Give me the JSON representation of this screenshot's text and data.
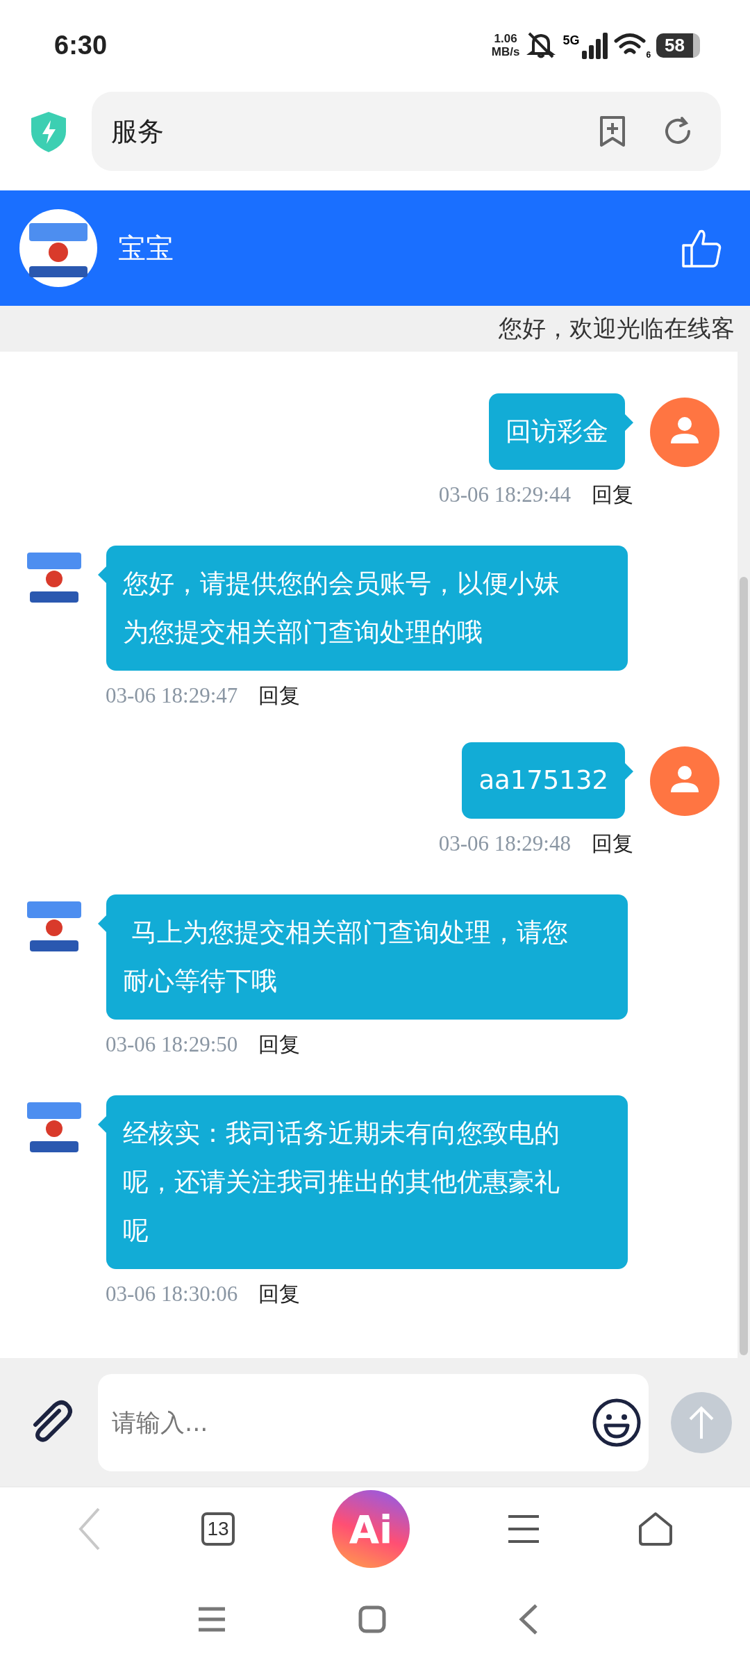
{
  "status_bar": {
    "time": "6:30",
    "speed_value": "1.06",
    "speed_unit": "MB/s",
    "network": "5G",
    "wifi_badge": "6",
    "battery": "58"
  },
  "address_bar": {
    "text": "服务"
  },
  "chat_header": {
    "title": "宝宝"
  },
  "notice": "您好，欢迎光临在线客",
  "messages": [
    {
      "kind": "sent",
      "text": "回访彩金",
      "time": "03-06 18:29:44",
      "reply_label": "回复"
    },
    {
      "kind": "received",
      "text": "您好，请提供您的会员账号，以便小妹为您提交相关部门查询处理的哦",
      "time": "03-06 18:29:47",
      "reply_label": "回复"
    },
    {
      "kind": "sent",
      "text": "aa175132",
      "time": "03-06 18:29:48",
      "reply_label": "回复"
    },
    {
      "kind": "received",
      "text": " 马上为您提交相关部门查询处理，请您耐心等待下哦",
      "time": "03-06 18:29:50",
      "reply_label": "回复"
    },
    {
      "kind": "received",
      "text": "经核实：我司话务近期未有向您致电的呢，还请关注我司推出的其他优惠豪礼呢",
      "time": "03-06 18:30:06",
      "reply_label": "回复"
    }
  ],
  "composer": {
    "placeholder": "请输入...",
    "send_disabled": true
  },
  "browser_nav": {
    "back_disabled": true,
    "tab_count": "13",
    "ai_label": "Ai"
  }
}
